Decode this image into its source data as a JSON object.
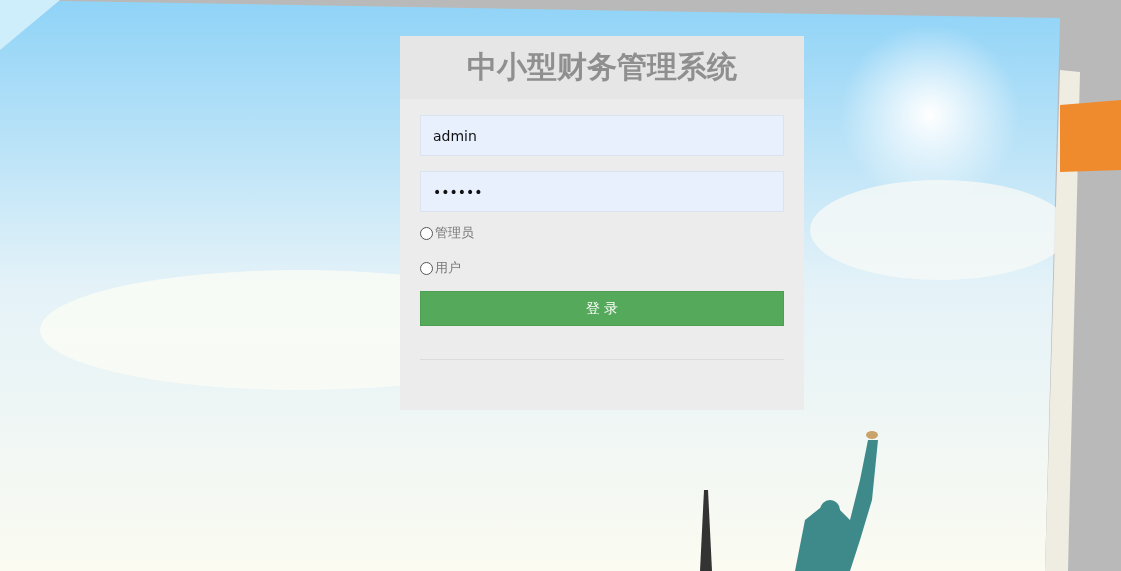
{
  "login_form": {
    "title": "中小型财务管理系统",
    "username": {
      "value": "admin"
    },
    "password": {
      "value": "••••••"
    },
    "roles": [
      {
        "label": "管理员",
        "selected": false
      },
      {
        "label": "用户",
        "selected": false
      }
    ],
    "submit_button": "登 录"
  }
}
